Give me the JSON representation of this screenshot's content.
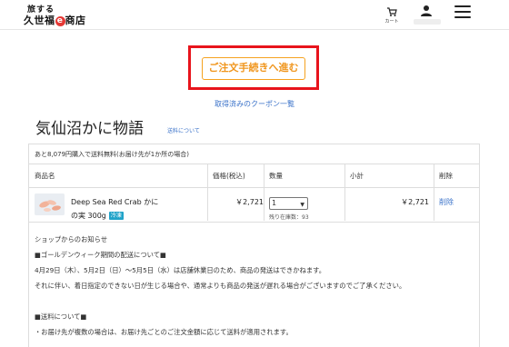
{
  "header": {
    "logo_top": "旅する",
    "logo_main_a": "久世福",
    "logo_e": "e",
    "logo_main_b": "商店",
    "cart_label": "カート"
  },
  "checkout": {
    "button_label": "ご注文手続きへ進む",
    "coupon_link": "取得済みのクーポン一覧"
  },
  "shop": {
    "title": "気仙沼かに物語",
    "shipping_link": "送料について"
  },
  "cart": {
    "free_shipping_note": "あと8,079円購入で送料無料(お届け先が1か所の場合)",
    "columns": [
      "商品名",
      "価格(税込)",
      "数量",
      "小計",
      "削除"
    ],
    "item": {
      "name_line1": "Deep Sea Red Crab かに",
      "name_line2": "の実 300g",
      "tag": "冷凍",
      "price": "￥2,721",
      "quantity": "1",
      "stock": "残り在庫数：93",
      "subtotal": "￥2,721",
      "delete": "削除"
    }
  },
  "notice": {
    "lines": [
      "ショップからのお知らせ",
      "■ゴールデンウィーク期間の配送について■",
      "4月29日（木）、5月2日（日）～5月5日（水）は店舗休業日のため、商品の発送はできかねます。",
      "それに伴い、着日指定のできない日が生じる場合や、通常よりも商品の発送が遅れる場合がございますのでご了承ください。",
      "",
      "■送料について■",
      "・お届け先が複数の場合は、お届け先ごとのご注文金額に応じて送料が適用されます。"
    ]
  },
  "colors": {
    "accent_orange": "#f0961e",
    "highlight_red": "#e8141c",
    "link_blue": "#3a72c9",
    "tag_cyan": "#20a3c9"
  },
  "icons": [
    "cart-icon",
    "user-icon",
    "menu-icon"
  ]
}
